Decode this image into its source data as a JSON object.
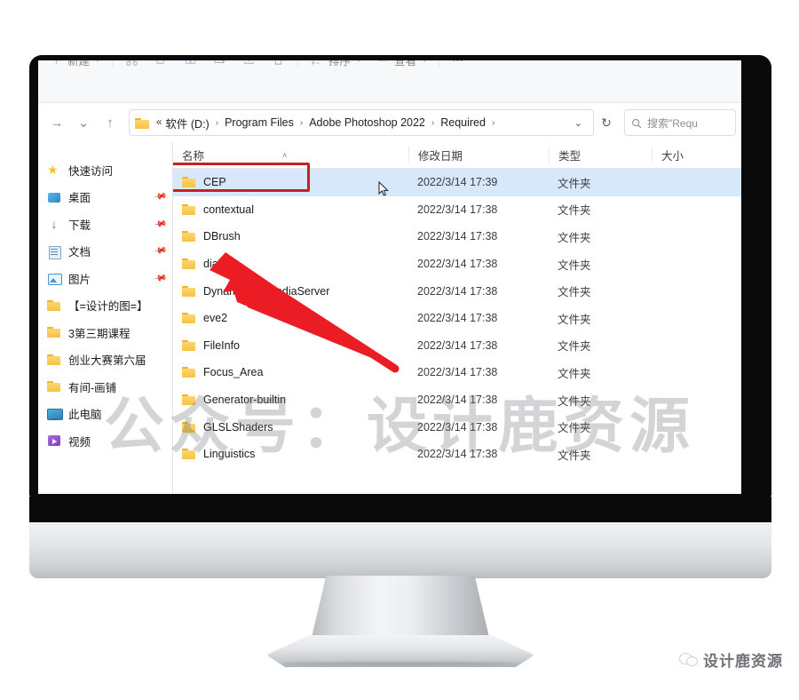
{
  "toolbar": {
    "new_label": "新建",
    "sort_label": "排序",
    "view_label": "查看",
    "more_label": "⋯",
    "icons": [
      "cut-icon",
      "copy-icon",
      "paste-icon",
      "rename-icon",
      "share-icon",
      "delete-icon"
    ]
  },
  "address": {
    "forward_glyph": "→",
    "recent_glyph": "⌄",
    "up_glyph": "↑",
    "overflow": "«",
    "crumbs": [
      "软件 (D:)",
      "Program Files",
      "Adobe Photoshop 2022",
      "Required"
    ],
    "separator": "›",
    "caret_glyph": "⌄",
    "refresh_glyph": "↻"
  },
  "search": {
    "placeholder": "搜索\"Requ"
  },
  "sidebar": {
    "items": [
      {
        "label": "快速访问",
        "icon": "star-icon",
        "pinned": false
      },
      {
        "label": "桌面",
        "icon": "desktop-icon",
        "pinned": true
      },
      {
        "label": "下载",
        "icon": "download-icon",
        "pinned": true
      },
      {
        "label": "文档",
        "icon": "documents-icon",
        "pinned": true
      },
      {
        "label": "图片",
        "icon": "pictures-icon",
        "pinned": true
      },
      {
        "label": "【=设计的图=】",
        "icon": "folder-icon",
        "pinned": false
      },
      {
        "label": "3第三期课程",
        "icon": "folder-icon",
        "pinned": false
      },
      {
        "label": "创业大赛第六届",
        "icon": "folder-icon",
        "pinned": false
      },
      {
        "label": "有间-画铺",
        "icon": "folder-icon",
        "pinned": false
      },
      {
        "label": "此电脑",
        "icon": "this-pc-icon",
        "pinned": false
      },
      {
        "label": "视频",
        "icon": "videos-icon",
        "pinned": false
      }
    ]
  },
  "filelist": {
    "columns": [
      "名称",
      "修改日期",
      "类型",
      "大小"
    ],
    "sort_caret": "˄",
    "rows": [
      {
        "name": "CEP",
        "date": "2022/3/14 17:39",
        "type": "文件夹",
        "size": "",
        "selected": true
      },
      {
        "name": "contextual",
        "date": "2022/3/14 17:38",
        "type": "文件夹",
        "size": "",
        "selected": false
      },
      {
        "name": "DBrush",
        "date": "2022/3/14 17:38",
        "type": "文件夹",
        "size": "",
        "selected": false
      },
      {
        "name": "dial",
        "date": "2022/3/14 17:38",
        "type": "文件夹",
        "size": "",
        "selected": false
      },
      {
        "name": "DynamicLinkMediaServer",
        "date": "2022/3/14 17:38",
        "type": "文件夹",
        "size": "",
        "selected": false
      },
      {
        "name": "eve2",
        "date": "2022/3/14 17:38",
        "type": "文件夹",
        "size": "",
        "selected": false
      },
      {
        "name": "FileInfo",
        "date": "2022/3/14 17:38",
        "type": "文件夹",
        "size": "",
        "selected": false
      },
      {
        "name": "Focus_Area",
        "date": "2022/3/14 17:38",
        "type": "文件夹",
        "size": "",
        "selected": false
      },
      {
        "name": "Generator-builtin",
        "date": "2022/3/14 17:38",
        "type": "文件夹",
        "size": "",
        "selected": false
      },
      {
        "name": "GLSLShaders",
        "date": "2022/3/14 17:38",
        "type": "文件夹",
        "size": "",
        "selected": false
      },
      {
        "name": "Linguistics",
        "date": "2022/3/14 17:38",
        "type": "文件夹",
        "size": "",
        "selected": false
      }
    ]
  },
  "annotation": {
    "box_color": "#c62020",
    "arrow_color": "#ec1c24",
    "target": "CEP"
  },
  "watermark": {
    "main": "公众号：设计鹿资源",
    "footer": "设计鹿资源"
  }
}
